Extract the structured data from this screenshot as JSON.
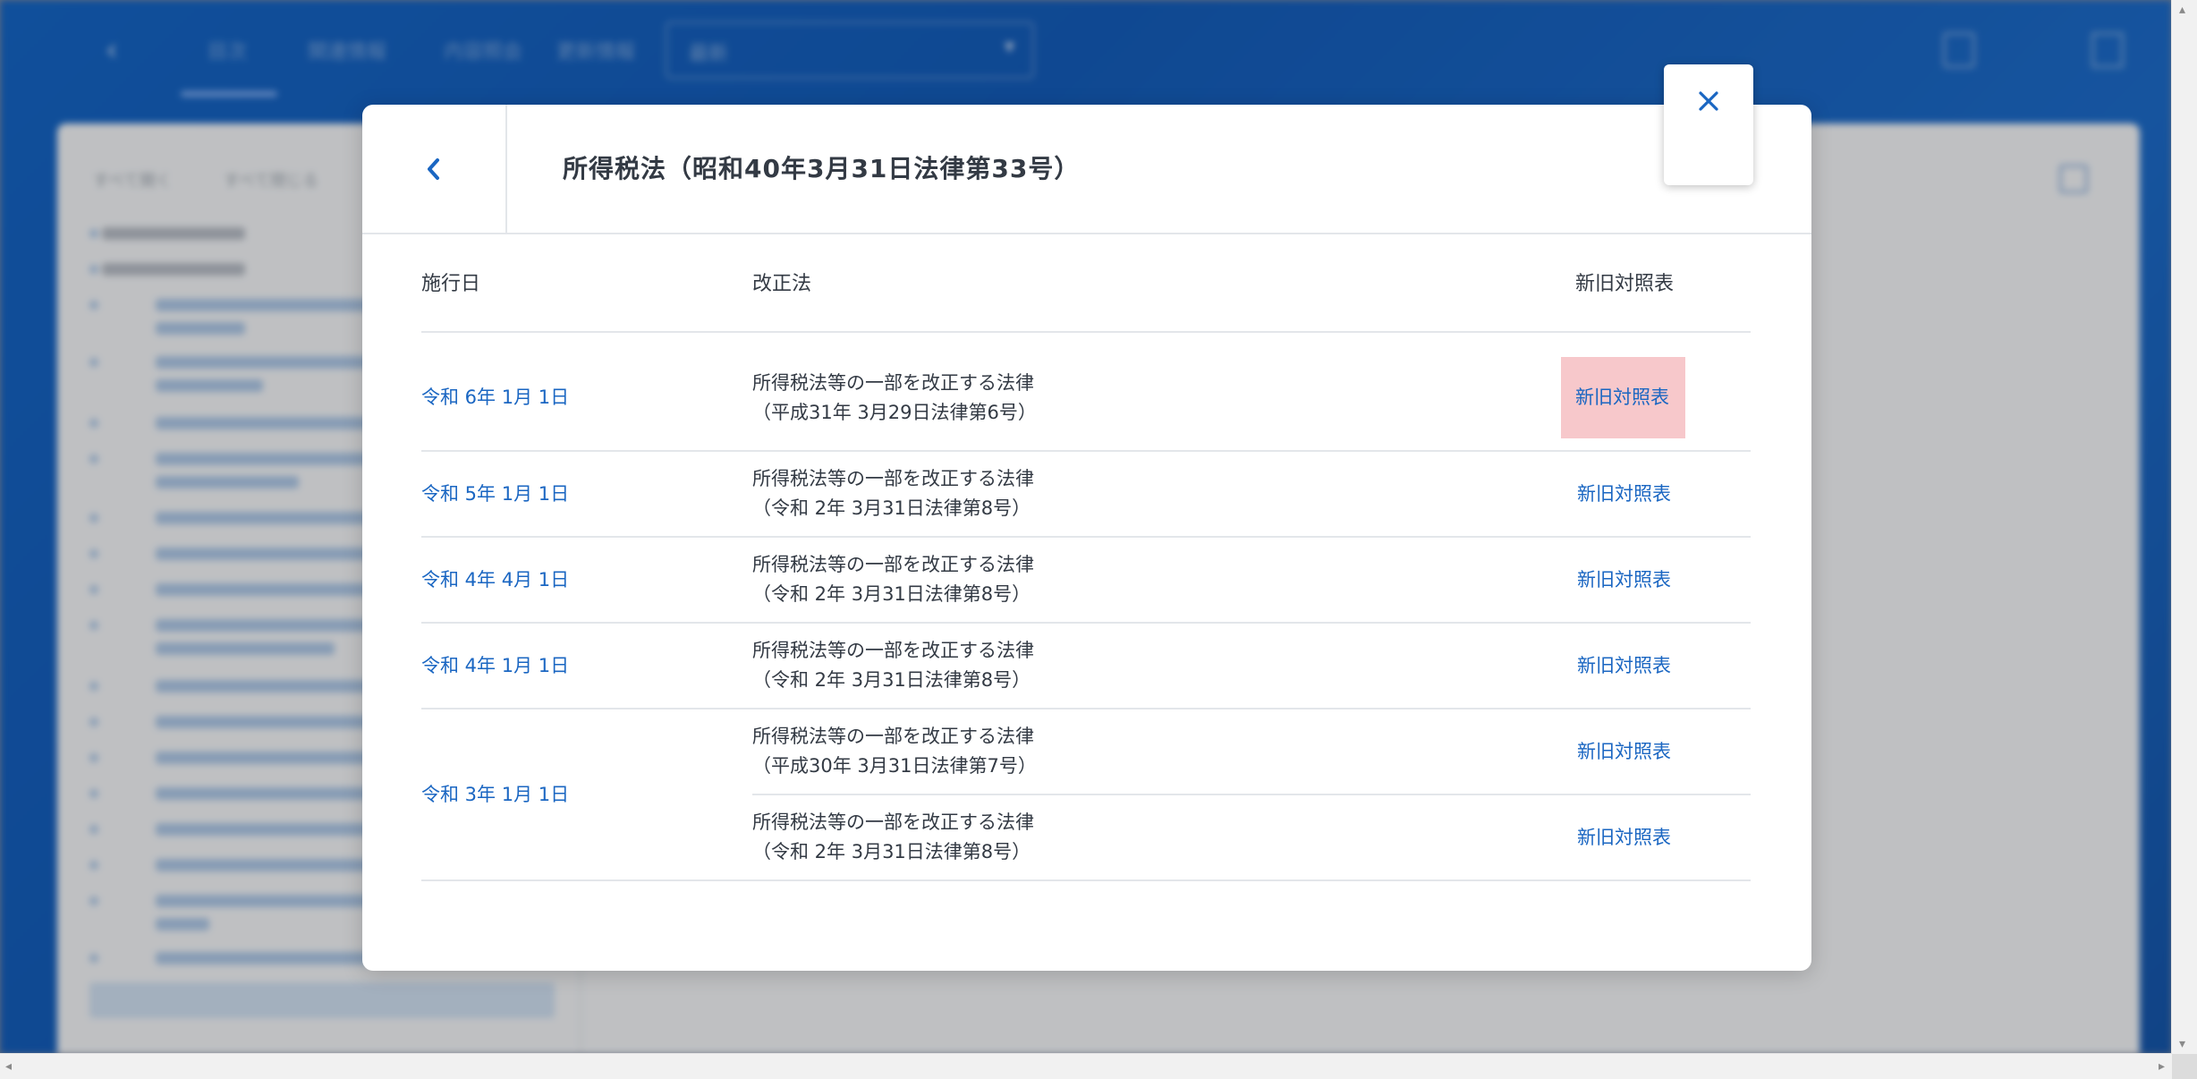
{
  "background": {
    "tabs": [
      "目次",
      "関連情報",
      "内容照会",
      "更新情報"
    ],
    "search_value": "最新",
    "sidebar_header": [
      "すべて開く",
      "すべて閉じる"
    ]
  },
  "modal": {
    "title": "所得税法（昭和40年3月31日法律第33号）",
    "columns": {
      "date": "施行日",
      "law": "改正法",
      "comparison": "新旧対照表"
    },
    "rows": [
      {
        "date": "令和 6年 1月 1日",
        "law_line1": "所得税法等の一部を改正する法律",
        "law_line2": "（平成31年 3月29日法律第6号）",
        "comparison": "新旧対照表",
        "highlighted": true
      },
      {
        "date": "令和 5年 1月 1日",
        "law_line1": "所得税法等の一部を改正する法律",
        "law_line2": "（令和 2年 3月31日法律第8号）",
        "comparison": "新旧対照表"
      },
      {
        "date": "令和 4年 4月 1日",
        "law_line1": "所得税法等の一部を改正する法律",
        "law_line2": "（令和 2年 3月31日法律第8号）",
        "comparison": "新旧対照表"
      },
      {
        "date": "令和 4年 1月 1日",
        "law_line1": "所得税法等の一部を改正する法律",
        "law_line2": "（令和 2年 3月31日法律第8号）",
        "comparison": "新旧対照表"
      },
      {
        "date": "令和 3年 1月 1日",
        "law_line1": "所得税法等の一部を改正する法律",
        "law_line2": "（平成30年 3月31日法律第7号）",
        "comparison": "新旧対照表"
      },
      {
        "date": "",
        "law_line1": "所得税法等の一部を改正する法律",
        "law_line2": "（令和 2年 3月31日法律第8号）",
        "comparison": "新旧対照表"
      }
    ]
  },
  "colors": {
    "link": "#1a66c2",
    "highlight": "#f7c8cb",
    "text": "#333a44",
    "brand_blue": "#0b5fc4"
  }
}
